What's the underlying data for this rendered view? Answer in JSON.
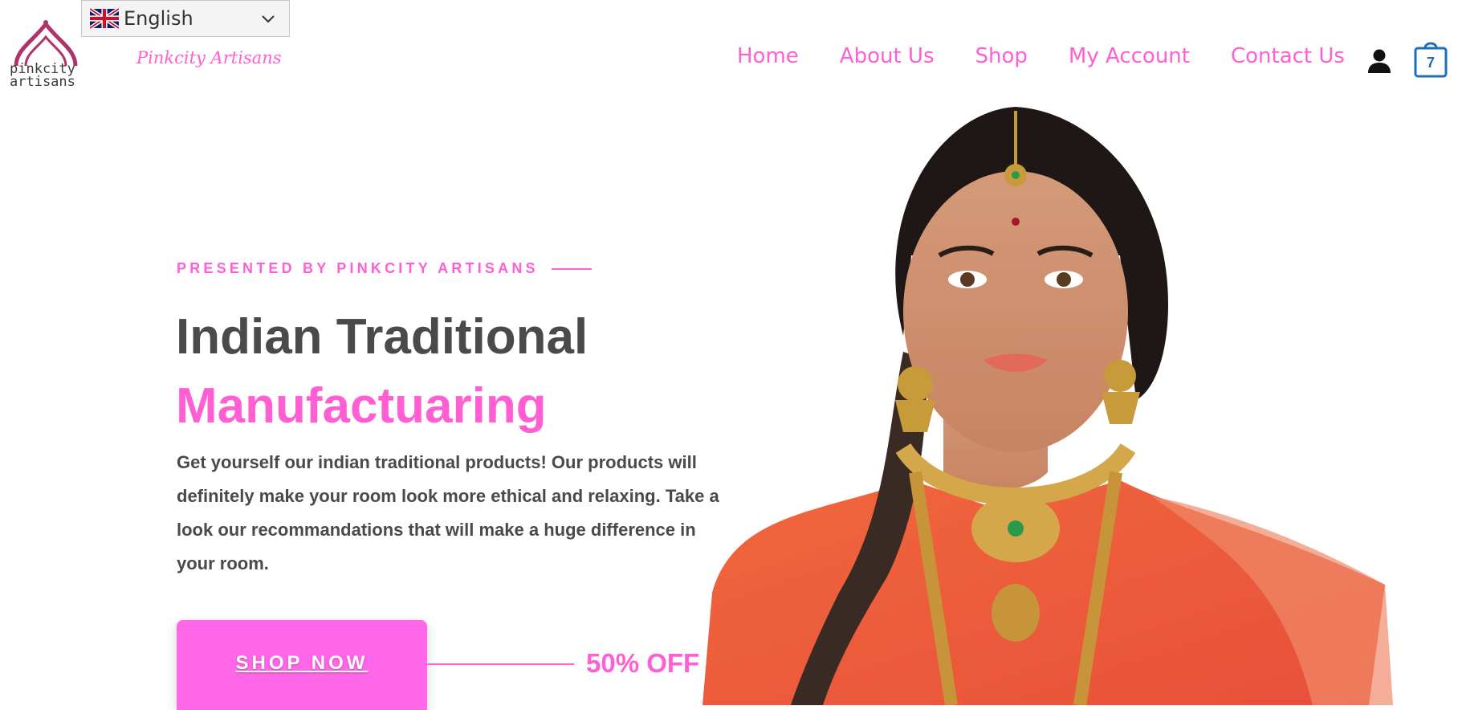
{
  "language": {
    "selected": "English",
    "flag_icon": "uk-flag-icon"
  },
  "brand": {
    "logo_text_line1": "pinkcity",
    "logo_text_line2": "artisans",
    "site_name": "Pinkcity Artisans"
  },
  "nav": {
    "items": [
      {
        "label": "Home"
      },
      {
        "label": "About Us"
      },
      {
        "label": "Shop"
      },
      {
        "label": "My Account"
      },
      {
        "label": "Contact Us"
      }
    ],
    "user_icon": "user-icon",
    "cart_icon": "shopping-bag-icon",
    "cart_count": "7"
  },
  "hero": {
    "tagline": "PRESENTED BY PINKCITY ARTISANS",
    "heading_line1": "Indian Traditional",
    "heading_line2": "Manufactuaring",
    "description": "Get yourself our indian traditional products! Our products will definitely make your room look more ethical and relaxing. Take a look our recommandations that will make a huge difference in your room.",
    "cta_label": "SHOP NOW",
    "offer": "50% OFF"
  },
  "colors": {
    "accent": "#ff5fd2",
    "button": "#ff66e8",
    "heading": "#4a4a4a",
    "cart": "#1c6fb8"
  }
}
